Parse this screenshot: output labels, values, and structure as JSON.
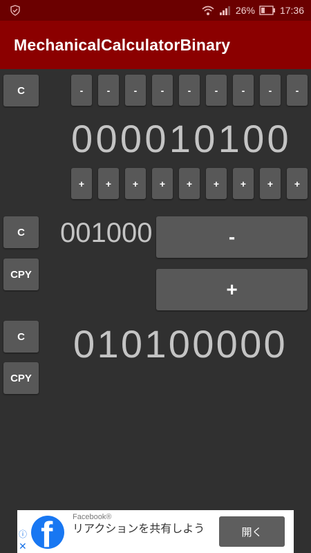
{
  "status_bar": {
    "signal_percent": "26%",
    "time": "17:36",
    "icons": [
      "shield-icon",
      "wifi-icon",
      "signal-icon",
      "battery-icon"
    ]
  },
  "app_bar": {
    "title": "MechanicalCalculatorBinary"
  },
  "top_section": {
    "clear_label": "C",
    "minus_labels": [
      "-",
      "-",
      "-",
      "-",
      "-",
      "-",
      "-",
      "-",
      "-"
    ],
    "digits": "000010100",
    "plus_labels": [
      "+",
      "+",
      "+",
      "+",
      "+",
      "+",
      "+",
      "+",
      "+"
    ]
  },
  "middle_section": {
    "clear_label": "C",
    "copy_label": "CPY",
    "digits": "001000",
    "minus_label": "-",
    "plus_label": "+"
  },
  "bottom_section": {
    "clear_label": "C",
    "copy_label": "CPY",
    "digits": "010100000"
  },
  "ad": {
    "sponsor": "Facebook®",
    "text": "リアクションを共有しよう",
    "button_label": "開く",
    "info_icon": "ⓘ",
    "close_icon": "✕"
  },
  "colors": {
    "status_bar": "#6b0000",
    "app_bar": "#8b0000",
    "background": "#303030",
    "button": "#585858",
    "digits": "#c4c4c4"
  }
}
